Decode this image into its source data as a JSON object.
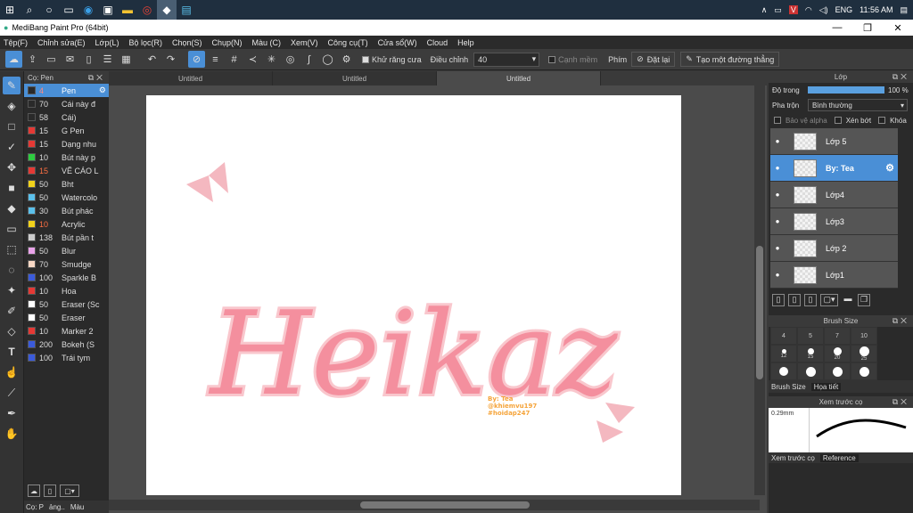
{
  "taskbar": {
    "tray": {
      "lang": "ENG",
      "time": "11:56 AM"
    }
  },
  "window": {
    "title": "MediBang Paint Pro (64bit)"
  },
  "menu": [
    "Tệp(F)",
    "Chỉnh sửa(E)",
    "Lớp(L)",
    "Bộ lọc(R)",
    "Chọn(S)",
    "Chụp(N)",
    "Màu (C)",
    "Xem(V)",
    "Công cụ(T)",
    "Cửa sổ(W)",
    "Cloud",
    "Help"
  ],
  "toolbar": {
    "antialias_label": "Khử răng cưa",
    "adjust_label": "Điều chỉnh",
    "adjust_value": "40",
    "edge_label": "Cạnh mềm",
    "key_label": "Phím",
    "reset_label": "Đặt lại",
    "straight_label": "Tạo một đường thẳng"
  },
  "brush_panel": {
    "header": "Cọ: Pen",
    "items": [
      {
        "size": "4",
        "name": "Pen",
        "color": "#2a2a2a",
        "selected": true
      },
      {
        "size": "70",
        "name": "Cái này đ",
        "color": "#2a2a2a"
      },
      {
        "size": "58",
        "name": "Cái)",
        "color": "#2a2a2a"
      },
      {
        "size": "15",
        "name": "G Pen",
        "color": "#e53935"
      },
      {
        "size": "15",
        "name": "Dạng nhu",
        "color": "#e53935"
      },
      {
        "size": "10",
        "name": "Bút này p",
        "color": "#2ecc40"
      },
      {
        "size": "15",
        "name": "VẼ CÁO L",
        "color": "#e53935",
        "warn": true
      },
      {
        "size": "50",
        "name": "Bht",
        "color": "#f1d21b"
      },
      {
        "size": "50",
        "name": "Watercolo",
        "color": "#5bc0eb"
      },
      {
        "size": "30",
        "name": "Bút phác",
        "color": "#5bc0eb"
      },
      {
        "size": "10",
        "name": "Acrylic",
        "color": "#f1d21b",
        "warn": true
      },
      {
        "size": "138",
        "name": "Bút pần t",
        "color": "#cccccc"
      },
      {
        "size": "50",
        "name": "Blur",
        "color": "#e9a3e9"
      },
      {
        "size": "70",
        "name": "Smudge",
        "color": "#f7d7c4"
      },
      {
        "size": "100",
        "name": "Sparkle B",
        "color": "#3b5bdb"
      },
      {
        "size": "10",
        "name": "Hoa",
        "color": "#e53935"
      },
      {
        "size": "50",
        "name": "Eraser (Sc",
        "color": "#ffffff"
      },
      {
        "size": "50",
        "name": "Eraser",
        "color": "#ffffff"
      },
      {
        "size": "10",
        "name": "Marker 2",
        "color": "#e53935"
      },
      {
        "size": "200",
        "name": "Bokeh (S",
        "color": "#3b5bdb"
      },
      {
        "size": "100",
        "name": "Trái tym",
        "color": "#3b5bdb"
      }
    ],
    "tabs": [
      "Cọ: P",
      "ảng..",
      "Màu"
    ]
  },
  "doc_tabs": [
    "Untitled",
    "Untitled",
    "Untitled"
  ],
  "canvas": {
    "artwork_text": "Heikaz",
    "credit": [
      "By: Tea",
      "@khiemvu197",
      "#hoidap247"
    ]
  },
  "layer_panel": {
    "header": "Lớp",
    "opacity_label": "Độ trong",
    "opacity_value": "100 %",
    "opacity_fraction": 1.0,
    "blend_label": "Pha trộn",
    "blend_value": "Bình thường",
    "protect_alpha": "Bảo vệ alpha",
    "clip": "Xén bớt",
    "lock": "Khóa",
    "layers": [
      {
        "name": "Lớp 5"
      },
      {
        "name": "By: Tea",
        "selected": true
      },
      {
        "name": "Lớp4"
      },
      {
        "name": "Lớp3"
      },
      {
        "name": "Lớp 2"
      },
      {
        "name": "Lớp1"
      }
    ]
  },
  "brush_size_panel": {
    "header": "Brush Size",
    "sizes": [
      "4",
      "5",
      "7",
      "10",
      "12",
      "15",
      "20",
      "25",
      "",
      "",
      "",
      ""
    ],
    "tabs": [
      "Brush Size",
      "Họa tiết"
    ]
  },
  "preview_panel": {
    "header": "Xem trước cọ",
    "size": "0.29mm",
    "tabs": [
      "Xem trước cọ",
      "Reference"
    ]
  }
}
